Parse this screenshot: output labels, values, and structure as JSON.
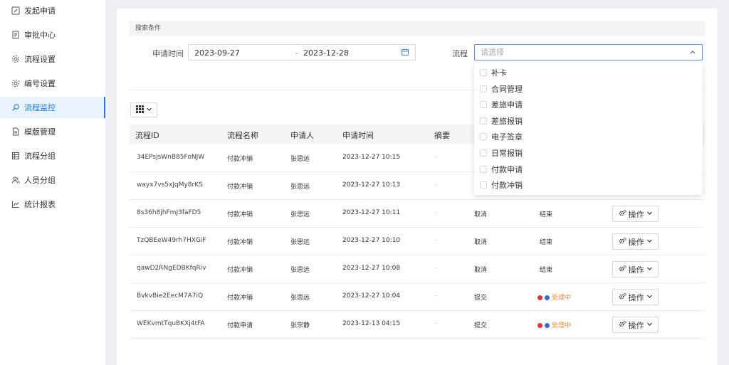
{
  "sidebar": {
    "items": [
      {
        "label": "发起申请",
        "icon": "edit-icon"
      },
      {
        "label": "审批中心",
        "icon": "approval-icon"
      },
      {
        "label": "流程设置",
        "icon": "gear-icon"
      },
      {
        "label": "编号设置",
        "icon": "gear-icon"
      },
      {
        "label": "流程监控",
        "icon": "search-icon",
        "active": true
      },
      {
        "label": "模版管理",
        "icon": "document-icon"
      },
      {
        "label": "流程分组",
        "icon": "grid-icon"
      },
      {
        "label": "人员分组",
        "icon": "users-icon"
      },
      {
        "label": "统计报表",
        "icon": "chart-icon"
      }
    ]
  },
  "search": {
    "section_title": "搜索条件",
    "date_label": "申请时间",
    "date_start": "2023-09-27",
    "date_sep": "–",
    "date_end": "2023-12-28",
    "flow_label": "流程",
    "flow_placeholder": "请选择"
  },
  "table": {
    "headers": [
      "流程ID",
      "流程名称",
      "申请人",
      "申请时间",
      "摘要"
    ],
    "rows": [
      {
        "id": "34EPsjsWnB85FoNJW",
        "name": "付款冲销",
        "applicant": "张思远",
        "time": "2023-12-27 10:15",
        "summary": "-",
        "action": "",
        "status": "",
        "op": "操作"
      },
      {
        "id": "wayx7vs5xJqMy8rKS",
        "name": "付款冲销",
        "applicant": "张思远",
        "time": "2023-12-27 10:13",
        "summary": "-",
        "action": "",
        "status": "",
        "op": "操作"
      },
      {
        "id": "8s36h8jhFmJ3faFD5",
        "name": "付款冲销",
        "applicant": "张思远",
        "time": "2023-12-27 10:11",
        "summary": "-",
        "action": "取消",
        "status": "结束",
        "op": "操作"
      },
      {
        "id": "TzQBEeW49rh7HXGiF",
        "name": "付款冲销",
        "applicant": "张思远",
        "time": "2023-12-27 10:10",
        "summary": "-",
        "action": "取消",
        "status": "结束",
        "op": "操作"
      },
      {
        "id": "qawD2RNgEDBKfqRiv",
        "name": "付款冲销",
        "applicant": "张思远",
        "time": "2023-12-27 10:08",
        "summary": "-",
        "action": "取消",
        "status": "结束",
        "op": "操作"
      },
      {
        "id": "BvkvBie2EecM7A7iQ",
        "name": "付款冲销",
        "applicant": "张思远",
        "time": "2023-12-27 10:04",
        "summary": "-",
        "action": "提交",
        "status": "处理中",
        "op": "操作"
      },
      {
        "id": "WEKvmtTquBKXj4tFA",
        "name": "付款申请",
        "applicant": "张宗静",
        "time": "2023-12-13 04:15",
        "summary": "-",
        "action": "提交",
        "status": "处理中",
        "op": "操作"
      }
    ]
  },
  "dropdown": {
    "options": [
      "补卡",
      "合同管理",
      "差旅申请",
      "差旅报销",
      "电子签章",
      "日常报销",
      "付款申请",
      "付款冲销"
    ]
  },
  "colors": {
    "accent": "#1f7ef0",
    "processing": "#f08a3c",
    "dot_red": "#e8333a",
    "dot_blue": "#2d6fe0"
  }
}
